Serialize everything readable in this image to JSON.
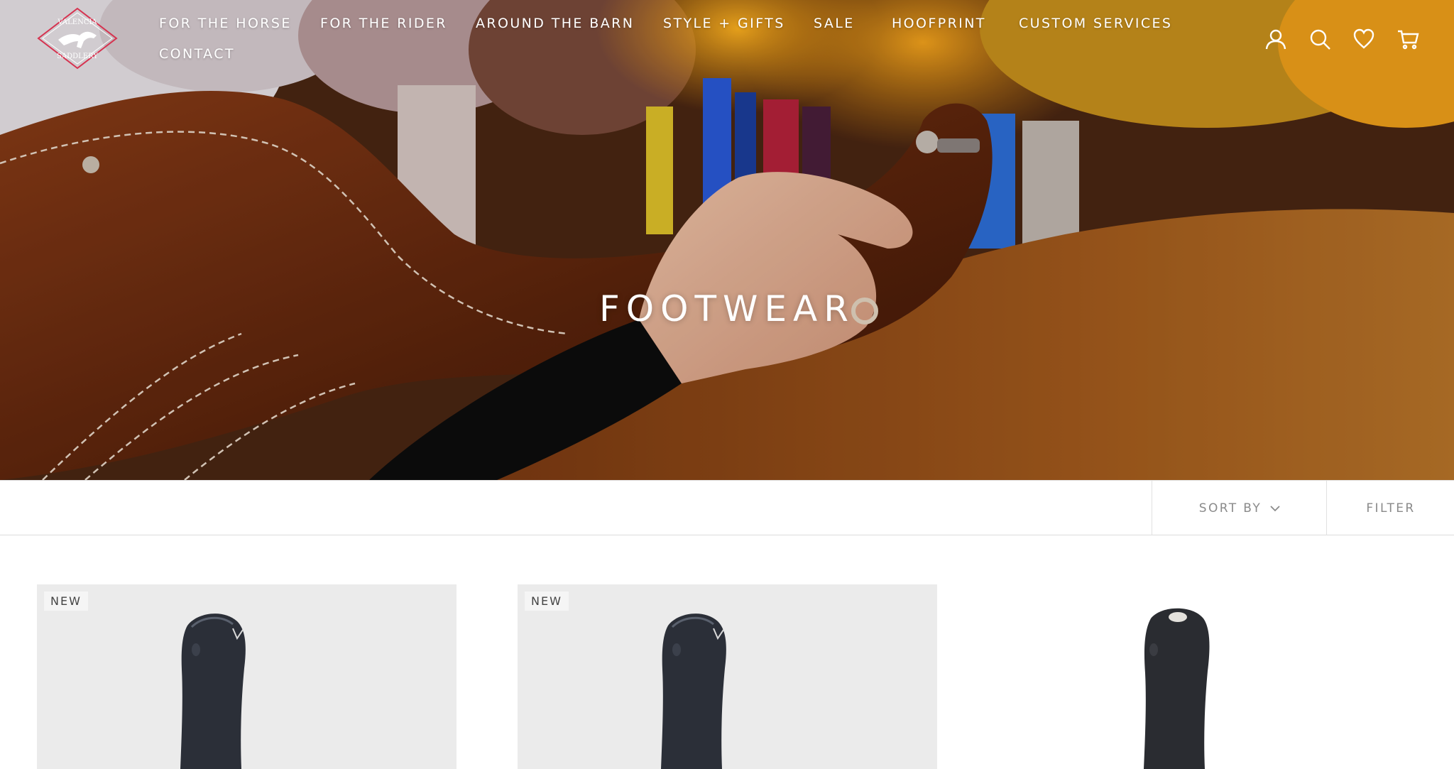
{
  "brand": {
    "logo_alt": "Valencia Saddlery",
    "logo_text_top": "VALENCIA",
    "logo_text_bottom": "SADDLERY"
  },
  "nav": {
    "items": [
      {
        "label": "FOR THE HORSE"
      },
      {
        "label": "FOR THE RIDER"
      },
      {
        "label": "AROUND THE BARN"
      },
      {
        "label": "STYLE + GIFTS"
      },
      {
        "label": "SALE"
      },
      {
        "label": "HOOFPRINT"
      },
      {
        "label": "CUSTOM SERVICES"
      },
      {
        "label": "CONTACT"
      }
    ]
  },
  "header_icons": [
    "account-icon",
    "search-icon",
    "wishlist-heart-icon",
    "cart-icon"
  ],
  "hero": {
    "title": "FOOTWEAR"
  },
  "toolbar": {
    "sort_label": "SORT BY",
    "filter_label": "FILTER"
  },
  "products": [
    {
      "badge": "NEW",
      "image": "tall-black-riding-boot"
    },
    {
      "badge": "NEW",
      "image": "tall-black-riding-boot"
    },
    {
      "image": "tall-black-riding-boot"
    }
  ],
  "colors": {
    "accent": "#d6324f",
    "text_muted": "#8a8a8a",
    "card_bg": "#ebebeb"
  }
}
